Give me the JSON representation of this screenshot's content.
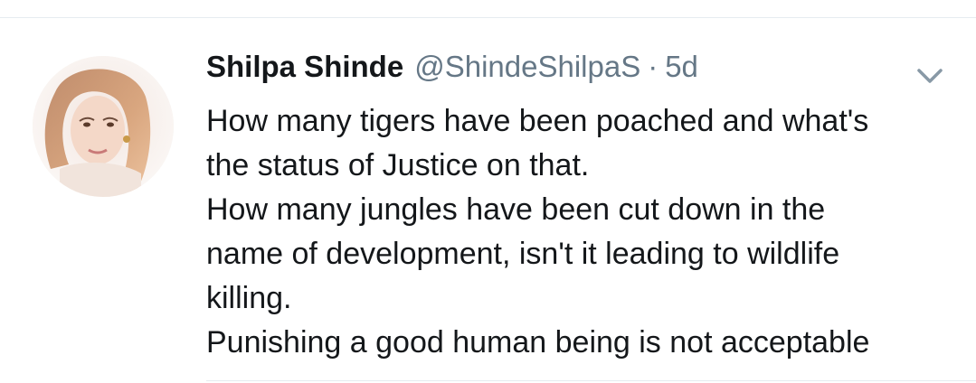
{
  "tweet": {
    "author_name": "Shilpa Shinde",
    "handle": "@ShindeShilpaS",
    "separator": "·",
    "time": "5d",
    "lines": [
      "How many tigers have been poached and what's",
      "the status of Justice on that.",
      "How many jungles have been cut down in the",
      "name of development, isn't it leading to wildlife",
      "killing.",
      "Punishing a good human being is not acceptable"
    ]
  },
  "icons": {
    "avatar": "user-avatar",
    "menu": "chevron-down-icon"
  },
  "colors": {
    "text": "#14171a",
    "secondary": "#657786",
    "divider": "#e6ecf0"
  }
}
